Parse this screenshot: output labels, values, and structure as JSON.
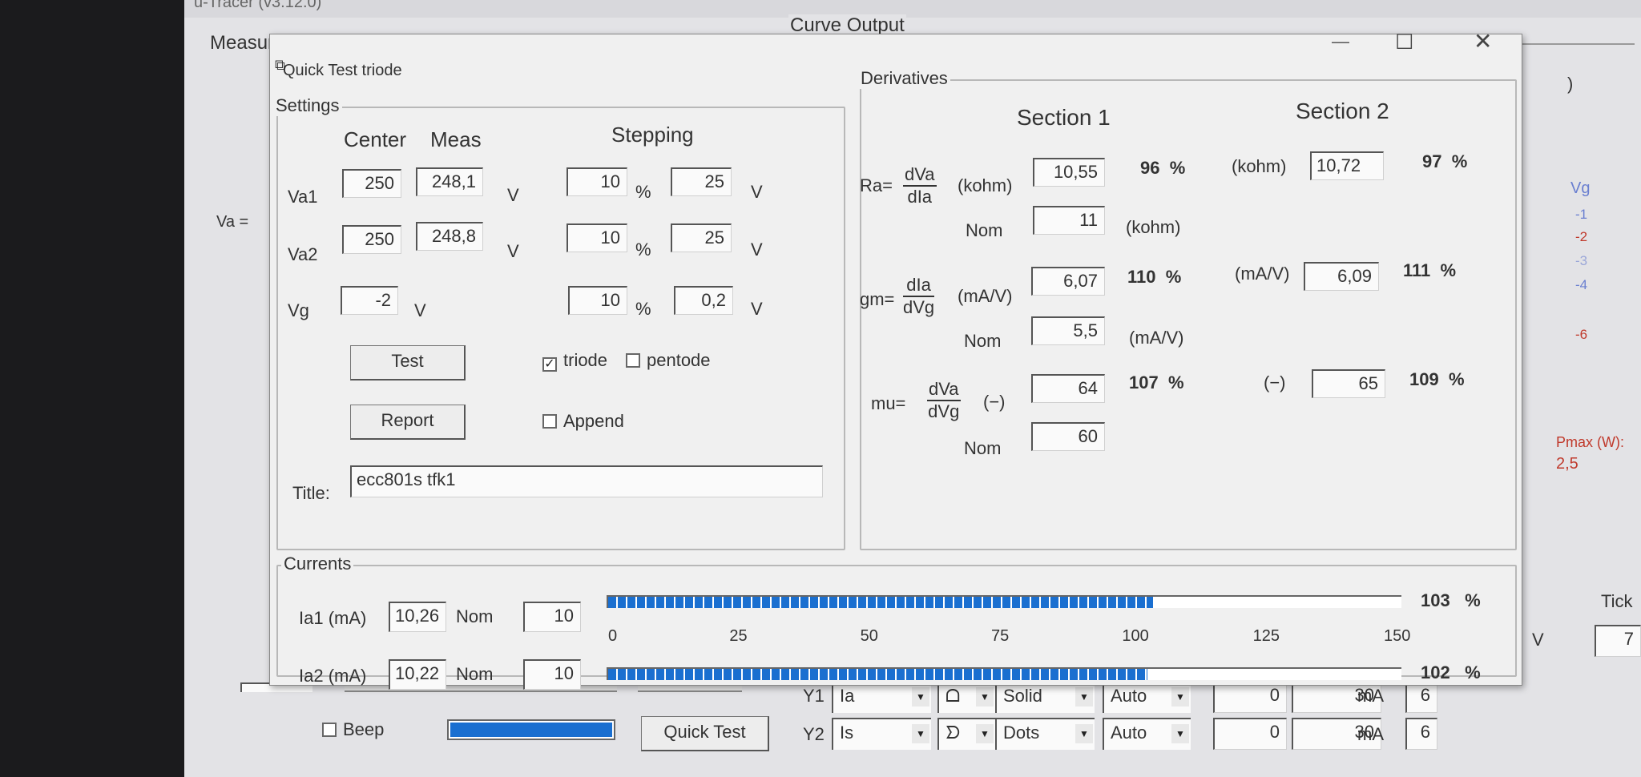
{
  "main": {
    "title": "u-Tracer (v3.12.0)",
    "measurement_setup_label": "Measurement Set-Up",
    "curve_output_label": "Curve Output",
    "va_label": "Va =",
    "vg_column_label": "Vg",
    "vg_values": [
      "-1",
      "-2",
      "-3",
      "-4",
      "-6"
    ],
    "pmax_label": "Pmax (W):",
    "pmax_value": "2,5",
    "ticks_label": "Tick",
    "right_top_glyph": ")",
    "beep_label": "Beep",
    "quick_test_button": "Quick Test",
    "v_unit": "V",
    "tick_value_1": "7",
    "y_rows": [
      {
        "label": "Y1",
        "axis": "Ia",
        "style": "Solid",
        "scale": "Auto",
        "min": "0",
        "max": "30",
        "unit": "mA",
        "tick": "6"
      },
      {
        "label": "Y2",
        "axis": "Is",
        "style": "Dots",
        "scale": "Auto",
        "min": "0",
        "max": "30",
        "unit": "mA",
        "tick": "6"
      }
    ]
  },
  "dialog": {
    "title": "Quick Test triode",
    "window_controls": {
      "minimize": "—",
      "maximize": "☐",
      "close": "✕"
    },
    "settings": {
      "group_label": "Settings",
      "col_center": "Center",
      "col_meas": "Meas",
      "col_stepping": "Stepping",
      "rows": [
        {
          "label": "Va1",
          "center": "250",
          "meas": "248,1",
          "unit": "V",
          "step_pct": "10",
          "pct_sign": "%",
          "step_v": "25",
          "step_unit": "V"
        },
        {
          "label": "Va2",
          "center": "250",
          "meas": "248,8",
          "unit": "V",
          "step_pct": "10",
          "pct_sign": "%",
          "step_v": "25",
          "step_unit": "V"
        },
        {
          "label": "Vg",
          "center": "-2",
          "unit": "V",
          "step_pct": "10",
          "pct_sign": "%",
          "step_v": "0,2",
          "step_unit": "V"
        }
      ],
      "test_button": "Test",
      "report_button": "Report",
      "triode_label": "triode",
      "triode_checked": true,
      "pentode_label": "pentode",
      "pentode_checked": false,
      "append_label": "Append",
      "append_checked": false,
      "title_label": "Title:",
      "title_value": "ecc801s tfk1"
    },
    "derivatives": {
      "group_label": "Derivatives",
      "section1": "Section 1",
      "section2": "Section 2",
      "ra": {
        "prefix": "Ra=",
        "num": "dVa",
        "den": "dIa",
        "unit": "(kohm)",
        "s1": "10,55",
        "s1_pct": "96",
        "s2_unit": "(kohm)",
        "s2": "10,72",
        "s2_pct": "97",
        "nom_label": "Nom",
        "nom": "11",
        "nom_unit": "(kohm)"
      },
      "gm": {
        "prefix": "gm=",
        "num": "dIa",
        "den": "dVg",
        "unit": "(mA/V)",
        "s1": "6,07",
        "s1_pct": "110",
        "s2_unit": "(mA/V)",
        "s2": "6,09",
        "s2_pct": "111",
        "nom_label": "Nom",
        "nom": "5,5",
        "nom_unit": "(mA/V)"
      },
      "mu": {
        "prefix": "mu=",
        "num": "dVa",
        "den": "dVg",
        "unit": "(−)",
        "s1": "64",
        "s1_pct": "107",
        "s2_unit": "(−)",
        "s2": "65",
        "s2_pct": "109",
        "nom_label": "Nom",
        "nom": "60"
      },
      "pct_sign": "%"
    },
    "currents": {
      "group_label": "Currents",
      "ia1": {
        "label": "Ia1 (mA)",
        "value": "10,26",
        "nom_label": "Nom",
        "nom": "10",
        "pct": "103",
        "fill_pct": 68.7
      },
      "ia2": {
        "label": "Ia2 (mA)",
        "value": "10,22",
        "nom_label": "Nom",
        "nom": "10",
        "pct": "102",
        "fill_pct": 68.0
      },
      "scale_ticks": [
        "0",
        "25",
        "50",
        "75",
        "100",
        "125",
        "150"
      ],
      "pct_sign": "%"
    }
  },
  "colors": {
    "bar": "#1a6fd0",
    "red_text": "#c0392b",
    "blue_text": "#6a7fd0"
  }
}
